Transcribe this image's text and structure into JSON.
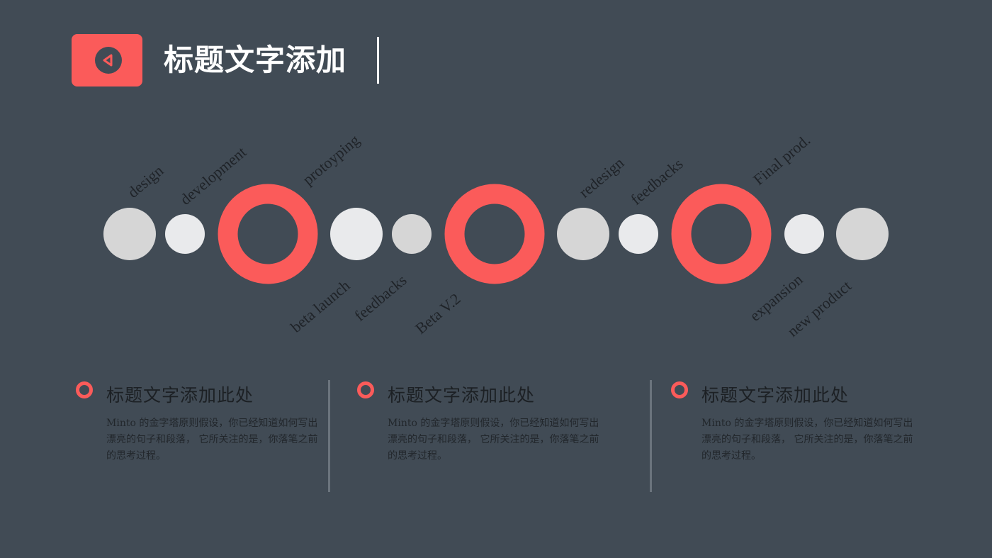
{
  "header": {
    "title": "标题文字添加",
    "badge_icon": "play-left-icon",
    "accent": "#fb5b5a",
    "background": "#414b55"
  },
  "timeline": {
    "items": [
      {
        "kind": "dot",
        "shade": "#d6d6d6"
      },
      {
        "kind": "dot",
        "shade": "#e9eaec"
      },
      {
        "kind": "ring",
        "shade": "#fb5b5a"
      },
      {
        "kind": "dot",
        "shade": "#e9eaec"
      },
      {
        "kind": "dot",
        "shade": "#d6d6d6"
      },
      {
        "kind": "ring",
        "shade": "#fb5b5a"
      },
      {
        "kind": "dot",
        "shade": "#d6d6d6"
      },
      {
        "kind": "dot",
        "shade": "#e9eaec"
      },
      {
        "kind": "ring",
        "shade": "#fb5b5a"
      },
      {
        "kind": "dot",
        "shade": "#e9eaec"
      },
      {
        "kind": "dot",
        "shade": "#d6d6d6"
      }
    ],
    "labels_top": [
      "design",
      "development",
      "protoyping",
      "redesign",
      "feedbacks",
      "Final prod."
    ],
    "labels_bottom": [
      "beta launch",
      "feedbacks",
      "Beta V.2",
      "expansion",
      "new product"
    ]
  },
  "columns": [
    {
      "title": "标题文字添加此处",
      "body": "Minto 的金字塔原则假设，你已经知道如何写出漂亮的句子和段落， 它所关注的是，你落笔之前的思考过程。"
    },
    {
      "title": "标题文字添加此处",
      "body": "Minto 的金字塔原则假设，你已经知道如何写出漂亮的句子和段落， 它所关注的是，你落笔之前的思考过程。"
    },
    {
      "title": "标题文字添加此处",
      "body": "Minto 的金字塔原则假设，你已经知道如何写出漂亮的句子和段落， 它所关注的是，你落笔之前的思考过程。"
    }
  ]
}
